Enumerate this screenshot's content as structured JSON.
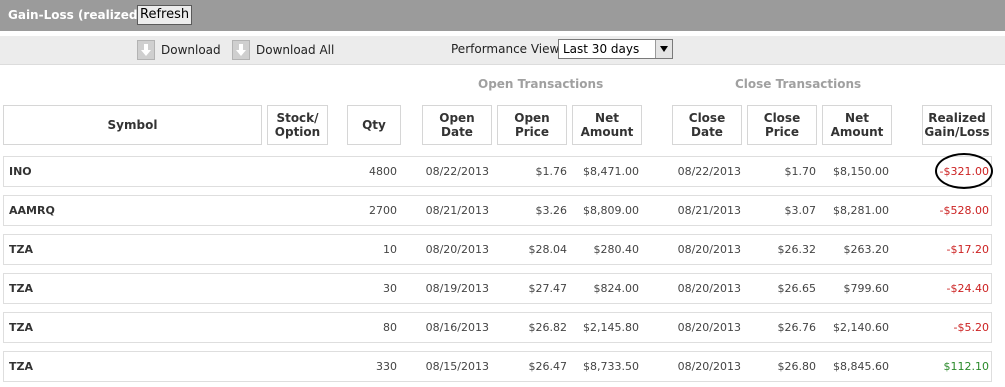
{
  "titlebar": {
    "title": "Gain-Loss (realized)",
    "refresh_label": "Refresh"
  },
  "toolbar": {
    "download_label": "Download",
    "download_all_label": "Download All"
  },
  "performance": {
    "label": "Performance View",
    "selected": "Last 30 days"
  },
  "groups": {
    "open": "Open Transactions",
    "close": "Close Transactions"
  },
  "headers": {
    "symbol": "Symbol",
    "stock_option": "Stock/\nOption",
    "qty": "Qty",
    "open_date": "Open\nDate",
    "open_price": "Open\nPrice",
    "net_amount_open": "Net\nAmount",
    "close_date": "Close\nDate",
    "close_price": "Close\nPrice",
    "net_amount_close": "Net\nAmount",
    "realized": "Realized\nGain/Loss"
  },
  "rows": [
    {
      "symbol": "INO",
      "qty": "4800",
      "open_date": "08/22/2013",
      "open_price": "$1.76",
      "open_net": "$8,471.00",
      "close_date": "08/22/2013",
      "close_price": "$1.70",
      "close_net": "$8,150.00",
      "realized": "-$321.00",
      "status": "neg"
    },
    {
      "symbol": "AAMRQ",
      "qty": "2700",
      "open_date": "08/21/2013",
      "open_price": "$3.26",
      "open_net": "$8,809.00",
      "close_date": "08/21/2013",
      "close_price": "$3.07",
      "close_net": "$8,281.00",
      "realized": "-$528.00",
      "status": "neg"
    },
    {
      "symbol": "TZA",
      "qty": "10",
      "open_date": "08/20/2013",
      "open_price": "$28.04",
      "open_net": "$280.40",
      "close_date": "08/20/2013",
      "close_price": "$26.32",
      "close_net": "$263.20",
      "realized": "-$17.20",
      "status": "neg"
    },
    {
      "symbol": "TZA",
      "qty": "30",
      "open_date": "08/19/2013",
      "open_price": "$27.47",
      "open_net": "$824.00",
      "close_date": "08/20/2013",
      "close_price": "$26.65",
      "close_net": "$799.60",
      "realized": "-$24.40",
      "status": "neg"
    },
    {
      "symbol": "TZA",
      "qty": "80",
      "open_date": "08/16/2013",
      "open_price": "$26.82",
      "open_net": "$2,145.80",
      "close_date": "08/20/2013",
      "close_price": "$26.76",
      "close_net": "$2,140.60",
      "realized": "-$5.20",
      "status": "neg"
    },
    {
      "symbol": "TZA",
      "qty": "330",
      "open_date": "08/15/2013",
      "open_price": "$26.47",
      "open_net": "$8,733.50",
      "close_date": "08/20/2013",
      "close_price": "$26.80",
      "close_net": "$8,845.60",
      "realized": "$112.10",
      "status": "pos"
    }
  ],
  "colors": {
    "titlebar": "#9b9b9b",
    "negative": "#cc2222",
    "positive": "#2a8a2a",
    "group_label": "#a0a0a0"
  },
  "icons": {
    "download": "download-icon",
    "download_all": "download-all-icon",
    "dropdown": "chevron-down-icon"
  }
}
